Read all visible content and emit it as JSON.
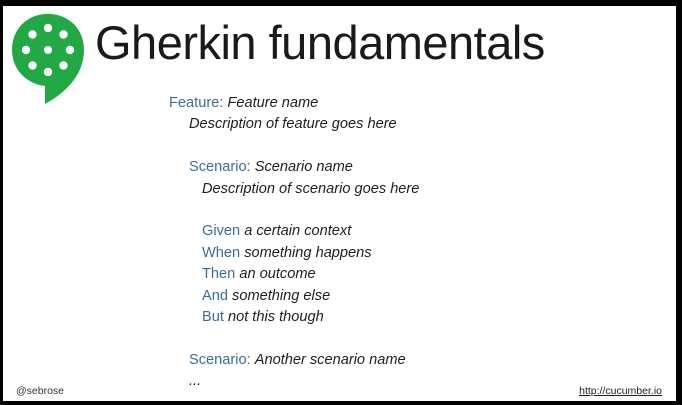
{
  "slide": {
    "title": "Gherkin fundamentals",
    "logo_icon": "cucumber-logo-icon",
    "colors": {
      "logo_green": "#23a846",
      "keyword_blue": "#3c6e95",
      "background": "#ffffff"
    }
  },
  "gherkin": {
    "feature": {
      "keyword": "Feature:",
      "name": "Feature name"
    },
    "feature_description": "Description of feature goes here",
    "scenario1": {
      "keyword": "Scenario:",
      "name": "Scenario name"
    },
    "scenario1_description": "Description of scenario goes here",
    "steps": [
      {
        "keyword": "Given",
        "text": "a certain context"
      },
      {
        "keyword": "When",
        "text": "something happens"
      },
      {
        "keyword": "Then",
        "text": "an outcome"
      },
      {
        "keyword": "And",
        "text": "something else"
      },
      {
        "keyword": "But",
        "text": "not this though"
      }
    ],
    "scenario2": {
      "keyword": "Scenario:",
      "name": "Another scenario name"
    },
    "ellipsis": "..."
  },
  "footer": {
    "author": "@sebrose",
    "link": "http://cucumber.io"
  }
}
